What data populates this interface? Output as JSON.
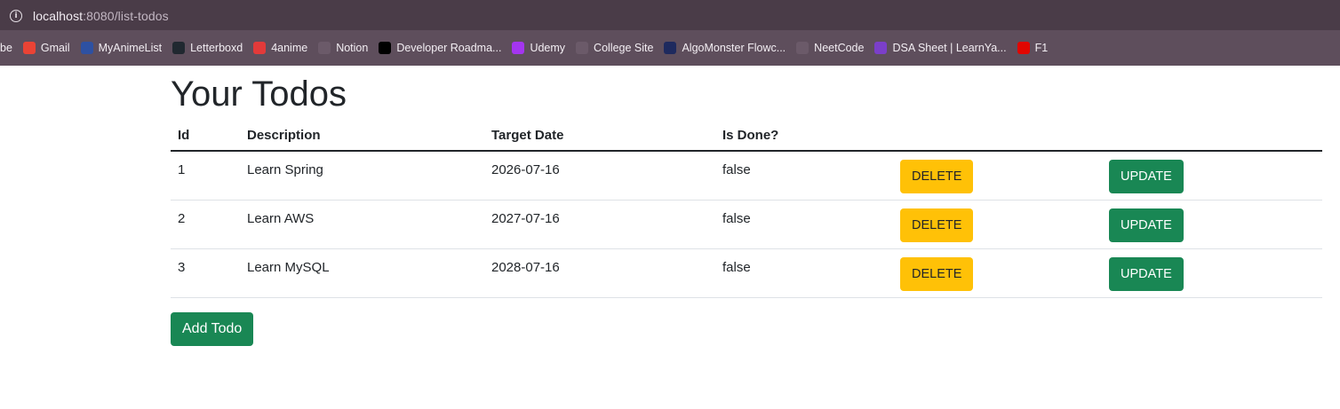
{
  "browser": {
    "url_host": "localhost",
    "url_rest": ":8080/list-todos",
    "bookmarks": [
      {
        "label": "be",
        "icon": "youtube-icon",
        "color": "#5e4e5c"
      },
      {
        "label": "Gmail",
        "icon": "gmail-icon",
        "color": "#ea4335"
      },
      {
        "label": "MyAnimeList",
        "icon": "myanimelist-icon",
        "color": "#2e51a2"
      },
      {
        "label": "Letterboxd",
        "icon": "letterboxd-icon",
        "color": "#202830"
      },
      {
        "label": "4anime",
        "icon": "4anime-icon",
        "color": "#e23a3a"
      },
      {
        "label": "Notion",
        "icon": "notion-icon",
        "color": "#6b5a69"
      },
      {
        "label": "Developer Roadma...",
        "icon": "roadmap-icon",
        "color": "#000000"
      },
      {
        "label": "Udemy",
        "icon": "udemy-icon",
        "color": "#a435f0"
      },
      {
        "label": "College Site",
        "icon": "globe-icon",
        "color": "#6b5a69"
      },
      {
        "label": "AlgoMonster Flowc...",
        "icon": "algomonster-icon",
        "color": "#1e2a5e"
      },
      {
        "label": "NeetCode",
        "icon": "neetcode-icon",
        "color": "#6b5a69"
      },
      {
        "label": "DSA Sheet | LearnYa...",
        "icon": "learnyard-icon",
        "color": "#7b3fc9"
      },
      {
        "label": "F1",
        "icon": "f1-icon",
        "color": "#e10600"
      }
    ]
  },
  "page": {
    "title": "Your Todos",
    "columns": {
      "id": "Id",
      "description": "Description",
      "target_date": "Target Date",
      "is_done": "Is Done?"
    },
    "rows": [
      {
        "id": "1",
        "description": "Learn Spring",
        "target_date": "2026-07-16",
        "is_done": "false"
      },
      {
        "id": "2",
        "description": "Learn AWS",
        "target_date": "2027-07-16",
        "is_done": "false"
      },
      {
        "id": "3",
        "description": "Learn MySQL",
        "target_date": "2028-07-16",
        "is_done": "false"
      }
    ],
    "delete_label": "DELETE",
    "update_label": "UPDATE",
    "add_label": "Add Todo"
  },
  "colors": {
    "warning": "#ffc107",
    "success": "#198754",
    "browser_frame": "#4a3c48"
  }
}
